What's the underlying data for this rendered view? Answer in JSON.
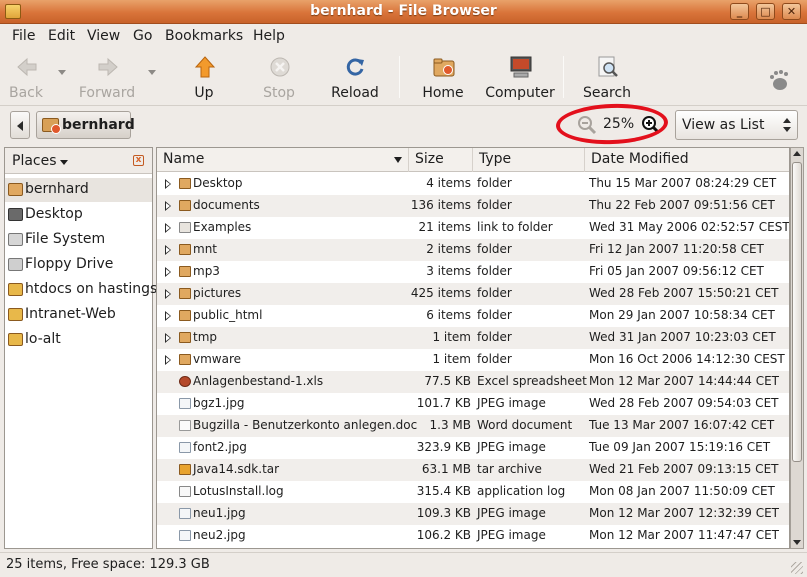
{
  "window": {
    "title": "bernhard - File Browser",
    "controls": {
      "minimize": "_",
      "maximize": "□",
      "close": "✕"
    }
  },
  "menu": [
    "File",
    "Edit",
    "View",
    "Go",
    "Bookmarks",
    "Help"
  ],
  "toolbar": {
    "back": "Back",
    "forward": "Forward",
    "up": "Up",
    "stop": "Stop",
    "reload": "Reload",
    "home": "Home",
    "computer": "Computer",
    "search": "Search"
  },
  "location": {
    "crumb": "bernhard",
    "zoom": "25%",
    "view_mode": "View as List"
  },
  "places": {
    "title": "Places",
    "items": [
      "bernhard",
      "Desktop",
      "File System",
      "Floppy Drive",
      "htdocs on hastings",
      "Intranet-Web",
      "lo-alt"
    ]
  },
  "columns": {
    "name": "Name",
    "size": "Size",
    "type": "Type",
    "date": "Date Modified"
  },
  "files": [
    {
      "name": "Desktop",
      "size": "4 items",
      "type": "folder",
      "date": "Thu 15 Mar 2007 08:24:29 CET"
    },
    {
      "name": "documents",
      "size": "136 items",
      "type": "folder",
      "date": "Thu 22 Feb 2007 09:51:56 CET"
    },
    {
      "name": "Examples",
      "size": "21 items",
      "type": "link to folder",
      "date": "Wed 31 May 2006 02:52:57 CEST"
    },
    {
      "name": "mnt",
      "size": "2 items",
      "type": "folder",
      "date": "Fri 12 Jan 2007 11:20:58 CET"
    },
    {
      "name": "mp3",
      "size": "3 items",
      "type": "folder",
      "date": "Fri 05 Jan 2007 09:56:12 CET"
    },
    {
      "name": "pictures",
      "size": "425 items",
      "type": "folder",
      "date": "Wed 28 Feb 2007 15:50:21 CET"
    },
    {
      "name": "public_html",
      "size": "6 items",
      "type": "folder",
      "date": "Mon 29 Jan 2007 10:58:34 CET"
    },
    {
      "name": "tmp",
      "size": "1 item",
      "type": "folder",
      "date": "Wed 31 Jan 2007 10:23:03 CET"
    },
    {
      "name": "vmware",
      "size": "1 item",
      "type": "folder",
      "date": "Mon 16 Oct 2006 14:12:30 CEST"
    },
    {
      "name": "Anlagenbestand-1.xls",
      "size": "77.5 KB",
      "type": "Excel spreadsheet",
      "date": "Mon 12 Mar 2007 14:44:44 CET"
    },
    {
      "name": "bgz1.jpg",
      "size": "101.7 KB",
      "type": "JPEG image",
      "date": "Wed 28 Feb 2007 09:54:03 CET"
    },
    {
      "name": "Bugzilla - Benutzerkonto anlegen.doc",
      "size": "1.3 MB",
      "type": "Word document",
      "date": "Tue 13 Mar 2007 16:07:42 CET"
    },
    {
      "name": "font2.jpg",
      "size": "323.9 KB",
      "type": "JPEG image",
      "date": "Tue 09 Jan 2007 15:19:16 CET"
    },
    {
      "name": "Java14.sdk.tar",
      "size": "63.1 MB",
      "type": "tar archive",
      "date": "Wed 21 Feb 2007 09:13:15 CET"
    },
    {
      "name": "LotusInstall.log",
      "size": "315.4 KB",
      "type": "application log",
      "date": "Mon 08 Jan 2007 11:50:09 CET"
    },
    {
      "name": "neu1.jpg",
      "size": "109.3 KB",
      "type": "JPEG image",
      "date": "Mon 12 Mar 2007 12:32:39 CET"
    },
    {
      "name": "neu2.jpg",
      "size": "106.2 KB",
      "type": "JPEG image",
      "date": "Mon 12 Mar 2007 11:47:47 CET"
    }
  ],
  "status": "25 items, Free space: 129.3 GB"
}
